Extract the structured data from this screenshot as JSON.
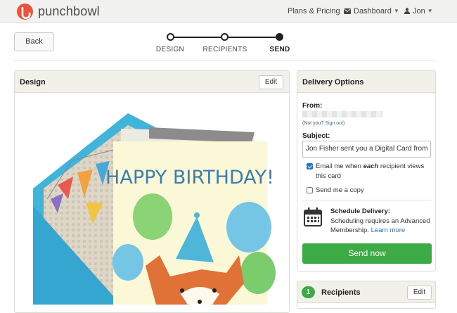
{
  "nav": {
    "logo": "punchbowl",
    "plans": "Plans & Pricing",
    "dashboard": "Dashboard",
    "user": "Jon"
  },
  "back_label": "Back",
  "steps": [
    {
      "label": "DESIGN",
      "state": "done"
    },
    {
      "label": "RECIPIENTS",
      "state": "done"
    },
    {
      "label": "SEND",
      "state": "current"
    }
  ],
  "design_panel": {
    "title": "Design",
    "edit_label": "Edit",
    "card_text": "HAPPY BIRTHDAY!"
  },
  "delivery": {
    "title": "Delivery Options",
    "from_label": "From:",
    "not_you": "(Not you? ",
    "sign_out": "Sign out",
    "not_you_close": ")",
    "subject_label": "Subject:",
    "subject_value": "Jon Fisher sent you a Digital Card from",
    "email_me_pre": "Email me when ",
    "email_me_em": "each",
    "email_me_post": " recipient views this card",
    "email_me_checked": true,
    "send_copy": "Send me a copy",
    "send_copy_checked": false,
    "schedule_title": "Schedule Delivery:",
    "schedule_text": "Scheduling requires an Advanced Membership. ",
    "learn_more": "Learn more",
    "send_now": "Send now"
  },
  "recipients_panel": {
    "count": "1",
    "title": "Recipients",
    "edit_label": "Edit"
  },
  "colors": {
    "brand": "#e9553c",
    "accent_green": "#3caa45",
    "link": "#2a73b8",
    "envelope": "#41b4dc"
  }
}
